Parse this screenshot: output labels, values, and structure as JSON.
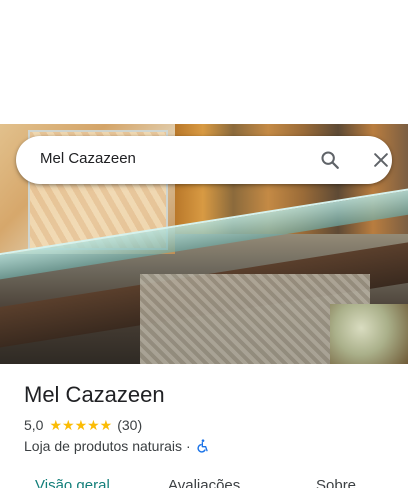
{
  "search": {
    "query": "Mel Cazazeen",
    "search_icon": "search-icon",
    "close_icon": "close-icon"
  },
  "place": {
    "name": "Mel Cazazeen",
    "rating": "5,0",
    "stars": "★★★★★",
    "reviews_count": "(30)",
    "category": "Loja de produtos naturais",
    "separator": "·",
    "accessibility_icon": "wheelchair-accessible-icon"
  },
  "tabs": [
    {
      "label": "Visão geral",
      "active": true
    },
    {
      "label": "Avaliações",
      "active": false
    },
    {
      "label": "Sobre",
      "active": false
    }
  ],
  "colors": {
    "star": "#fbbc04",
    "active_tab": "#137f7a",
    "accessibility": "#1a73e8"
  }
}
